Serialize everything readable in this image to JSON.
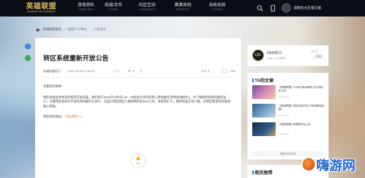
{
  "nav": {
    "logo": "英雄联盟",
    "logo_sub": "LEAGUE OF LEGENDS",
    "items": [
      {
        "cn": "游戏资料",
        "en": "GAME INFO"
      },
      {
        "cn": "商城/合作",
        "en": "STORE"
      },
      {
        "cn": "社区互动",
        "en": "COMMUNITY"
      },
      {
        "cn": "赛事官网",
        "en": "ESPORTS"
      },
      {
        "cn": "自助系统",
        "en": "SYSTEM"
      }
    ],
    "user_text": "请绑定大区或注销"
  },
  "breadcrumb": {
    "home": "英雄联盟首页",
    "mid": "社区个人中心",
    "current": "文章详情"
  },
  "article": {
    "title": "转区系统重新开放公告",
    "author": "英雄联盟官方",
    "date": "2022-04-08 17:46:37",
    "views": "3",
    "likes": "0",
    "words": "473 字",
    "comments": "638",
    "greeting": "亲爱的召唤师：",
    "paragraph": "转区系统技术改造的需求已经完成，我们将于2022年4月8日 18：00恢复全部大区转入转出服务(黑色玫瑰除外)，为了确保转系统的服务运行，尽量转区系统在不同的时间都可以进行，试运行转区转区人数将限制在500人/日，并逐步扩大，最终恢复正常人数，有转区需求的玩家请耐心等候。",
    "link_label": "转区系统地址：",
    "link_text": "点击跳转>>>",
    "like_count": "638"
  },
  "author_card": {
    "avatar_text": "LOL",
    "name": "英雄联盟官方",
    "stats": "1 粉丝 | 5 分享稿件",
    "follow_count": "44.7万",
    "follow_btn": "关注"
  },
  "ta_articles": {
    "title": "TA的文章",
    "items": [
      {
        "title": "【英雄联盟】12月8日版本更新公告 新皮肤上线",
        "date": "2022-12-08"
      },
      {
        "title": "【英雄联盟】转区系统开放 (不包括黑色玫瑰)",
        "date": "2022-11-25"
      },
      {
        "title": "【英雄联盟】新赛季开启公告",
        "date": "2022-11-10"
      }
    ],
    "more": "更多TA的文章"
  },
  "related": {
    "title": "相关推荐"
  },
  "watermark": {
    "text": "嗨游网"
  },
  "colors": {
    "nav_bg": "#0b0e14",
    "accent_gold": "#d9b65a",
    "accent_blue": "#1f7ce0",
    "link_orange": "#e07a2c"
  }
}
